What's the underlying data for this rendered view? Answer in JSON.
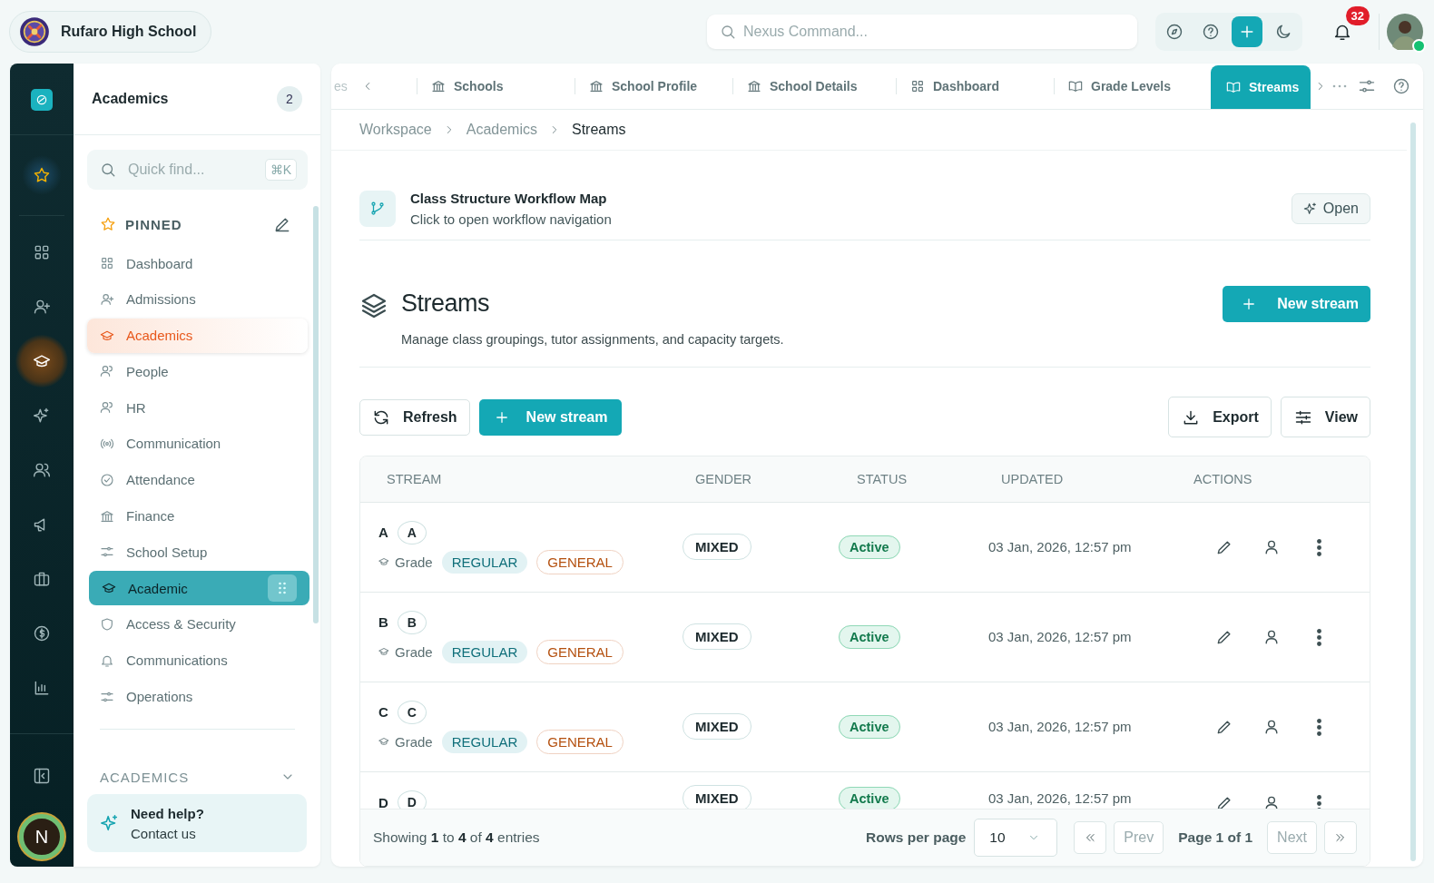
{
  "topbar": {
    "school_name": "Rufaro High School",
    "search": {
      "placeholder": "Nexus Command..."
    },
    "notifications": "32",
    "online": true
  },
  "rail": {
    "items": [
      {
        "selected": false
      },
      {
        "selected": false
      },
      {
        "selected": true
      },
      {
        "selected": false
      },
      {
        "selected": false
      },
      {
        "selected": false
      },
      {
        "selected": false
      },
      {
        "selected": false
      },
      {
        "selected": false
      }
    ],
    "user_initial": "N"
  },
  "sidebar": {
    "title": "Academics",
    "count": "2",
    "search": {
      "placeholder": "Quick find...",
      "shortcut": "⌘K"
    },
    "pinned_heading": "PINNED",
    "items": [
      {
        "label": "Dashboard",
        "selected": false,
        "dragging": false
      },
      {
        "label": "Admissions",
        "selected": false,
        "dragging": false
      },
      {
        "label": "Academics",
        "selected": true,
        "dragging": false
      },
      {
        "label": "People",
        "selected": false,
        "dragging": false
      },
      {
        "label": "HR",
        "selected": false,
        "dragging": false
      },
      {
        "label": "Communication",
        "selected": false,
        "dragging": false
      },
      {
        "label": "Attendance",
        "selected": false,
        "dragging": false
      },
      {
        "label": "Finance",
        "selected": false,
        "dragging": false
      },
      {
        "label": "School Setup",
        "selected": false,
        "dragging": false
      },
      {
        "label": "Academic",
        "selected": false,
        "dragging": true
      },
      {
        "label": "Access & Security",
        "selected": false,
        "dragging": false
      },
      {
        "label": "Communications",
        "selected": false,
        "dragging": false
      },
      {
        "label": "Operations",
        "selected": false,
        "dragging": false
      }
    ],
    "section": {
      "label": "ACADEMICS",
      "expanded": true
    },
    "help": {
      "title": "Need help?",
      "link": "Contact us"
    }
  },
  "tabs": [
    {
      "label": "es",
      "selected": false
    },
    {
      "label": "Schools",
      "selected": false
    },
    {
      "label": "School Profile",
      "selected": false
    },
    {
      "label": "School Details",
      "selected": false
    },
    {
      "label": "Dashboard",
      "selected": false
    },
    {
      "label": "Grade Levels",
      "selected": false
    },
    {
      "label": "Streams",
      "selected": true
    }
  ],
  "breadcrumb": [
    "Workspace",
    "Academics",
    "Streams"
  ],
  "workflow": {
    "title": "Class Structure Workflow Map",
    "subtitle": "Click to open workflow navigation",
    "button": "Open"
  },
  "page": {
    "title": "Streams",
    "subtitle": "Manage class groupings, tutor assignments, and capacity targets.",
    "primary_button": "New stream"
  },
  "toolbar": {
    "refresh": "Refresh",
    "new": "New stream",
    "export": "Export",
    "view": "View"
  },
  "table": {
    "columns": [
      "STREAM",
      "GENDER",
      "STATUS",
      "UPDATED",
      "ACTIONS"
    ],
    "rows": [
      {
        "name": "A",
        "code": "A",
        "grade": "Grade",
        "tags": [
          "REGULAR",
          "GENERAL"
        ],
        "gender": "MIXED",
        "status": "Active",
        "updated": "03 Jan, 2026, 12:57 pm"
      },
      {
        "name": "B",
        "code": "B",
        "grade": "Grade",
        "tags": [
          "REGULAR",
          "GENERAL"
        ],
        "gender": "MIXED",
        "status": "Active",
        "updated": "03 Jan, 2026, 12:57 pm"
      },
      {
        "name": "C",
        "code": "C",
        "grade": "Grade",
        "tags": [
          "REGULAR",
          "GENERAL"
        ],
        "gender": "MIXED",
        "status": "Active",
        "updated": "03 Jan, 2026, 12:57 pm"
      },
      {
        "name": "D",
        "code": "D",
        "gender": "MIXED",
        "status": "Active",
        "updated": "03 Jan, 2026, 12:57 pm"
      }
    ]
  },
  "footer": {
    "showing": "Showing **1** to **4** of **4** entries",
    "rows_label": "Rows per page",
    "rows_value": "10",
    "prev": "Prev",
    "page": "Page 1 of 1",
    "next": "Next",
    "prev_disabled": true,
    "next_disabled": true
  }
}
